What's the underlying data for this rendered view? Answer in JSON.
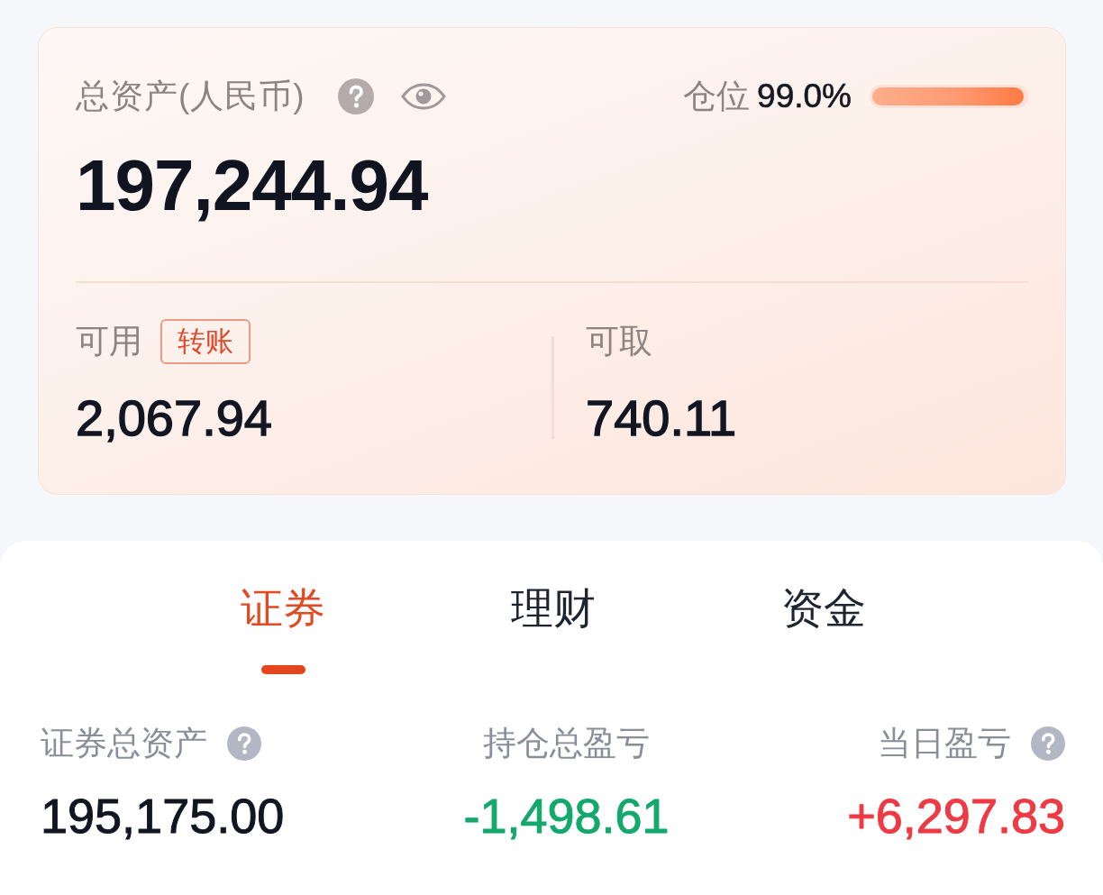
{
  "summary": {
    "label": "总资产(人民币)",
    "total": "197,244.94",
    "position": {
      "label": "仓位",
      "value": "99.0%",
      "level": 0.99
    },
    "available": {
      "label": "可用",
      "action": "转账",
      "value": "2,067.94"
    },
    "withdrawable": {
      "label": "可取",
      "value": "740.11"
    }
  },
  "tabs": [
    {
      "label": "证券",
      "selected": true
    },
    {
      "label": "理财",
      "selected": false
    },
    {
      "label": "资金",
      "selected": false
    }
  ],
  "stats": [
    {
      "label": "证券总资产",
      "has_help": true,
      "value": "195,175.00",
      "color": "#111622"
    },
    {
      "label": "持仓总盈亏",
      "has_help": false,
      "value": "-1,498.61",
      "color": "#13a86c"
    },
    {
      "label": "当日盈亏",
      "has_help": true,
      "value": "+6,297.83",
      "color": "#ee3a44"
    }
  ]
}
